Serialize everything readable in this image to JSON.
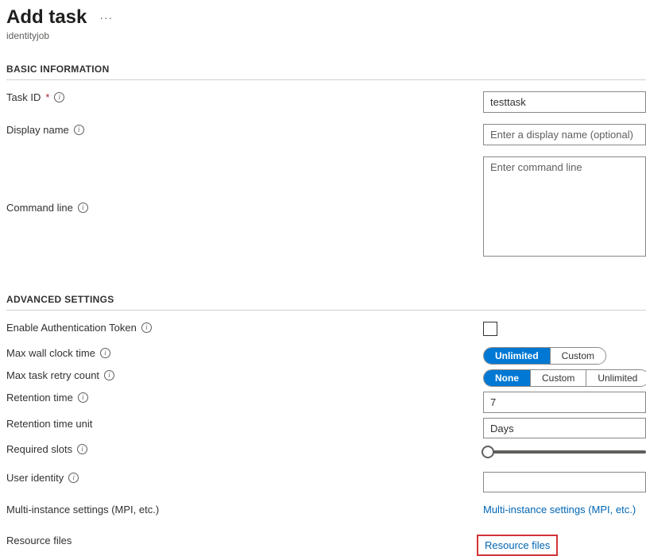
{
  "header": {
    "title": "Add task",
    "subtitle": "identityjob"
  },
  "sections": {
    "basic": "BASIC INFORMATION",
    "advanced": "ADVANCED SETTINGS"
  },
  "basic": {
    "task_id_label": "Task ID",
    "task_id_value": "testtask",
    "display_name_label": "Display name",
    "display_name_placeholder": "Enter a display name (optional)",
    "command_line_label": "Command line",
    "command_line_placeholder": "Enter command line"
  },
  "advanced": {
    "enable_auth_label": "Enable Authentication Token",
    "max_wall_label": "Max wall clock time",
    "max_wall_options": [
      "Unlimited",
      "Custom"
    ],
    "max_wall_active": "Unlimited",
    "max_retry_label": "Max task retry count",
    "max_retry_options": [
      "None",
      "Custom",
      "Unlimited"
    ],
    "max_retry_active": "None",
    "retention_time_label": "Retention time",
    "retention_time_value": "7",
    "retention_unit_label": "Retention time unit",
    "retention_unit_value": "Days",
    "required_slots_label": "Required slots",
    "user_identity_label": "User identity",
    "multi_instance_label": "Multi-instance settings (MPI, etc.)",
    "multi_instance_link": "Multi-instance settings (MPI, etc.)",
    "resource_files_label": "Resource files",
    "resource_files_link": "Resource files"
  }
}
